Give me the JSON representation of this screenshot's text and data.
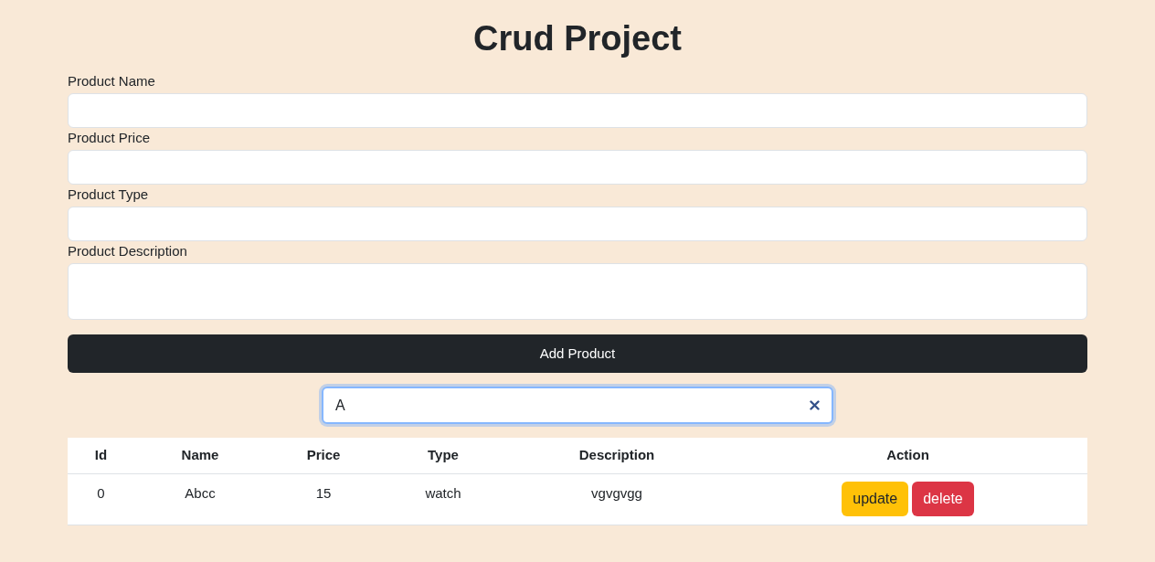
{
  "title": "Crud Project",
  "form": {
    "fields": [
      {
        "kind": "input",
        "label": "Product Name"
      },
      {
        "kind": "input",
        "label": "Product Price"
      },
      {
        "kind": "input",
        "label": "Product Type"
      },
      {
        "kind": "textarea",
        "label": "Product Description"
      }
    ],
    "submit_button": "Add Product"
  },
  "search": {
    "value": "A",
    "focused": true
  },
  "table": {
    "columns": [
      "Id",
      "Name",
      "Price",
      "Type",
      "Description",
      "Action"
    ],
    "rows": [
      {
        "cells": [
          "0",
          "Abcc",
          "15",
          "watch",
          "vgvgvgg"
        ],
        "actions": [
          {
            "kind": "warning",
            "label": "update"
          },
          {
            "kind": "danger",
            "label": "delete"
          }
        ]
      }
    ]
  }
}
